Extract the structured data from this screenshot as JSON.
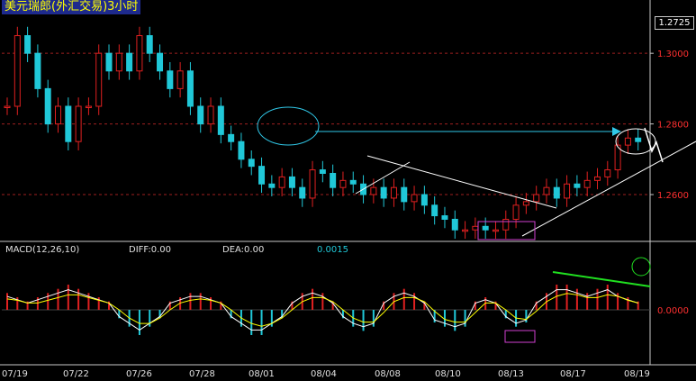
{
  "title": "美元瑞郎(外汇交易)3小时",
  "current_price": "1.2725",
  "macd_header": {
    "indicator": "MACD(12,26,10)",
    "diff": "DIFF:0.00",
    "dea": "DEA:0.00",
    "value": "0.0015"
  },
  "colors": {
    "up": "#e02020",
    "down": "#20c8d8",
    "grid": "#a02020",
    "diff_line": "#ffffff",
    "dea_line": "#ffff00",
    "annotation_cyan": "#30c8e8",
    "annotation_white": "#ffffff",
    "annotation_magenta": "#d040d0",
    "annotation_green": "#20e020"
  },
  "chart_data": [
    {
      "type": "candlestick",
      "x_ticks": [
        "07/19",
        "07/22",
        "07/26",
        "07/28",
        "08/01",
        "08/04",
        "08/08",
        "08/10",
        "08/13",
        "08/17",
        "08/19"
      ],
      "y_ticks": [
        "1.3000",
        "1.2800",
        "1.2600"
      ],
      "ylim": [
        1.247,
        1.3105
      ],
      "grid": true,
      "price_path": [
        1.285,
        1.305,
        1.3,
        1.29,
        1.28,
        1.285,
        1.275,
        1.285,
        1.285,
        1.3,
        1.295,
        1.3,
        1.295,
        1.305,
        1.3,
        1.295,
        1.29,
        1.295,
        1.285,
        1.28,
        1.285,
        1.277,
        1.275,
        1.27,
        1.268,
        1.263,
        1.262,
        1.265,
        1.262,
        1.259,
        1.267,
        1.266,
        1.262,
        1.264,
        1.263,
        1.26,
        1.262,
        1.259,
        1.262,
        1.258,
        1.26,
        1.257,
        1.254,
        1.253,
        1.25,
        1.25,
        1.251,
        1.25,
        1.25,
        1.253,
        1.257,
        1.258,
        1.26,
        1.262,
        1.259,
        1.263,
        1.262,
        1.264,
        1.265,
        1.267,
        1.274,
        1.276,
        1.275
      ]
    },
    {
      "type": "bar",
      "name": "MACD(12,26,10)",
      "y_ticks": [
        "0.0000"
      ],
      "ylim": [
        -0.006,
        0.006
      ],
      "values": [
        0.002,
        0.0015,
        0.001,
        0.0015,
        0.002,
        0.0025,
        0.003,
        0.0025,
        0.002,
        0.0015,
        0.001,
        -0.001,
        -0.002,
        -0.003,
        -0.002,
        -0.001,
        0.001,
        0.0015,
        0.002,
        0.002,
        0.0015,
        0.001,
        -0.001,
        -0.002,
        -0.003,
        -0.003,
        -0.002,
        -0.001,
        0.001,
        0.002,
        0.0025,
        0.002,
        0.001,
        -0.001,
        -0.002,
        -0.0025,
        -0.002,
        0.001,
        0.002,
        0.0025,
        0.002,
        0.001,
        -0.0015,
        -0.002,
        -0.0025,
        -0.002,
        0.001,
        0.0015,
        0.001,
        -0.001,
        -0.002,
        -0.0015,
        0.001,
        0.002,
        0.003,
        0.003,
        0.0025,
        0.002,
        0.0025,
        0.003,
        0.002,
        0.0015,
        0.001
      ]
    }
  ]
}
